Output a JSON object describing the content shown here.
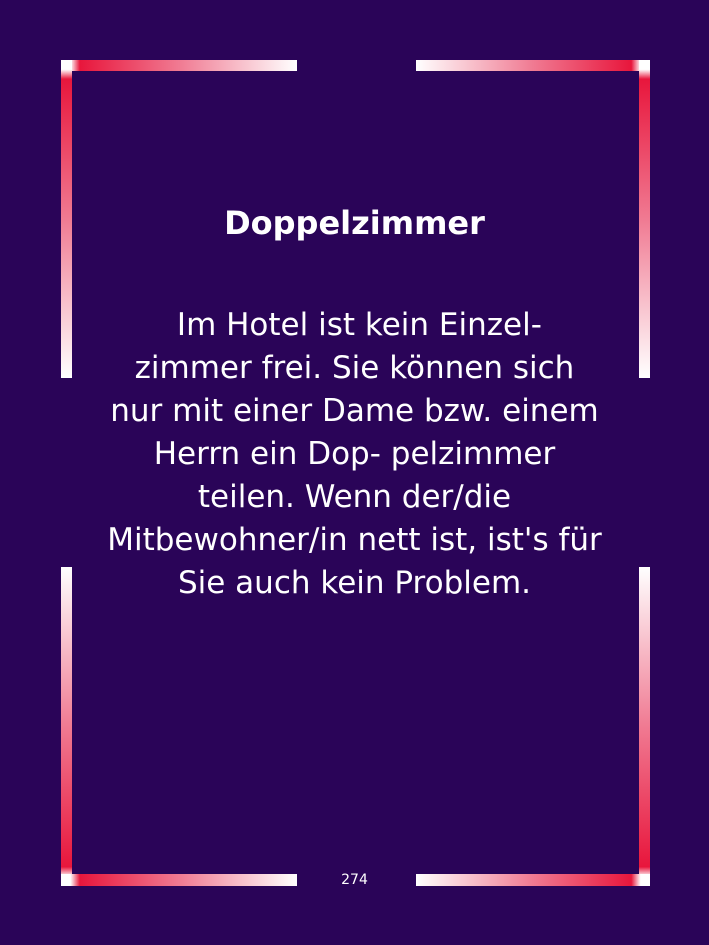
{
  "card": {
    "title": "Doppelzimmer",
    "body_lines": [
      " Im Hotel ist kein Einzel-",
      "zimmer frei. Sie können sich",
      "nur mit einer Dame bzw. einem",
      "Herrn ein Dop- pelzimmer",
      "teilen. Wenn der/die",
      "Mitbewohner/in nett ist, ist's für",
      "Sie auch kein Problem."
    ],
    "page_number": "274"
  },
  "colors": {
    "background": "#2a0458",
    "text": "#ffffff",
    "frame_accent": "#e8163c",
    "frame_light": "#ffffff"
  }
}
